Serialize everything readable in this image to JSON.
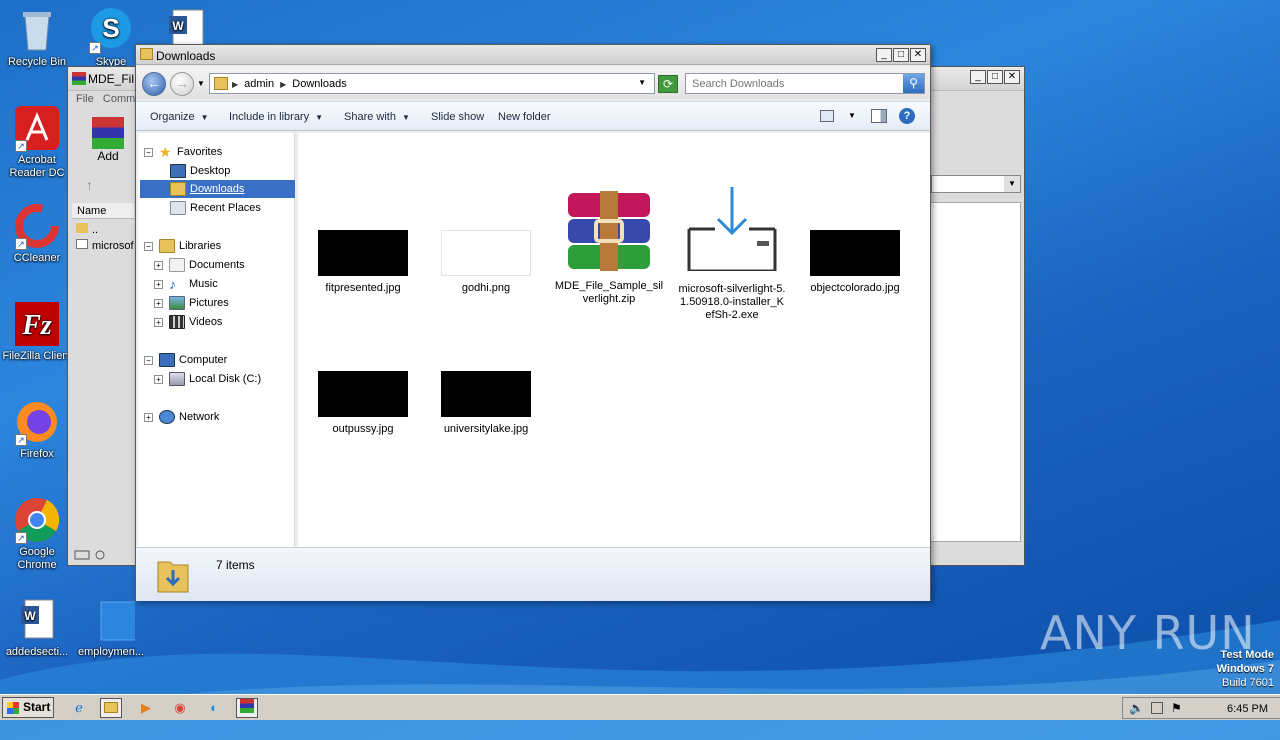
{
  "desktop": {
    "icons": [
      {
        "label": "Recycle Bin",
        "icon": "recycle-bin-icon"
      },
      {
        "label": "Skype",
        "icon": "skype-icon"
      },
      {
        "label": "",
        "icon": "word-document-icon"
      },
      {
        "label": "Acrobat Reader DC",
        "icon": "acrobat-icon"
      },
      {
        "label": "CCleaner",
        "icon": "ccleaner-icon"
      },
      {
        "label": "FileZilla Client",
        "icon": "filezilla-icon"
      },
      {
        "label": "Firefox",
        "icon": "firefox-icon"
      },
      {
        "label": "Google Chrome",
        "icon": "chrome-icon"
      },
      {
        "label": "addedsecti...",
        "icon": "word-document-icon"
      },
      {
        "label": "employmen...",
        "icon": "blank-document-icon"
      }
    ],
    "watermark": "ANY RUN",
    "test_mode": {
      "line1": "Test Mode",
      "line2": "Windows 7",
      "line3": "Build 7601"
    }
  },
  "background_window": {
    "title": "MDE_Fil",
    "menu": [
      "File",
      "Comm"
    ],
    "add_label": "Add",
    "column_name": "Name",
    "rows": [
      "..",
      "microsof"
    ]
  },
  "explorer": {
    "title": "Downloads",
    "breadcrumb": [
      "admin",
      "Downloads"
    ],
    "search_placeholder": "Search Downloads",
    "commands": [
      "Organize",
      "Include in library",
      "Share with",
      "Slide show",
      "New folder"
    ],
    "nav": {
      "favorites": "Favorites",
      "desktop": "Desktop",
      "downloads": "Downloads",
      "recent": "Recent Places",
      "libraries": "Libraries",
      "documents": "Documents",
      "music": "Music",
      "pictures": "Pictures",
      "videos": "Videos",
      "computer": "Computer",
      "local_disk": "Local Disk (C:)",
      "network": "Network"
    },
    "files": [
      {
        "name": "fitpresented.jpg",
        "type": "jpg-dark"
      },
      {
        "name": "godhi.png",
        "type": "png-white"
      },
      {
        "name": "MDE_File_Sample_silverlight.zip",
        "type": "rar-archive"
      },
      {
        "name": "microsoft-silverlight-5.1.50918.0-installer_KefSh-2.exe",
        "type": "installer"
      },
      {
        "name": "objectcolorado.jpg",
        "type": "jpg-dark"
      },
      {
        "name": "outpussy.jpg",
        "type": "jpg-dark"
      },
      {
        "name": "universitylake.jpg",
        "type": "jpg-dark"
      }
    ],
    "status_text": "7 items"
  },
  "taskbar": {
    "start_label": "Start",
    "clock": "6:45 PM"
  },
  "colors": {
    "selection": "#3a6fc6",
    "desktop_blue": "#1e6fc8"
  }
}
